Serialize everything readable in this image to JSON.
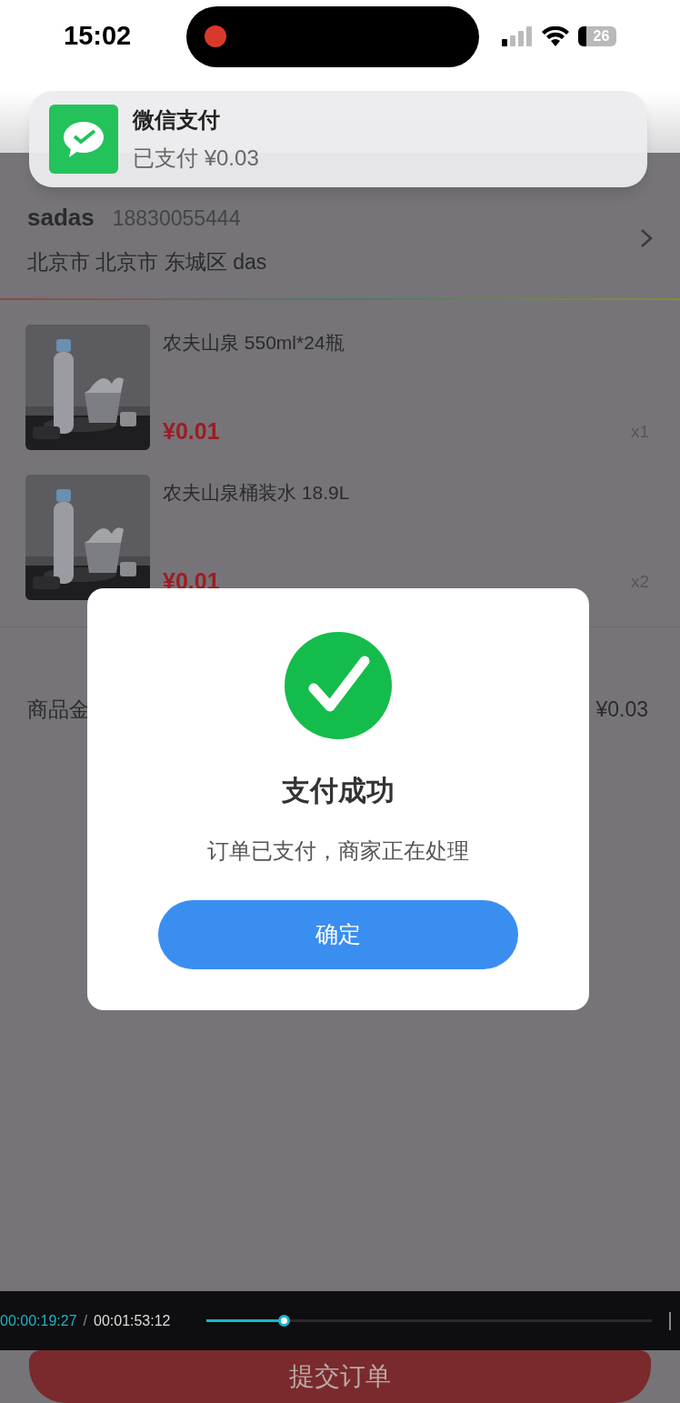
{
  "status_bar": {
    "time": "15:02",
    "battery": "26"
  },
  "notification": {
    "app": "微信支付",
    "message": "已支付 ¥0.03"
  },
  "address": {
    "name": "sadas",
    "phone": "18830055444",
    "detail": "北京市 北京市 东城区 das"
  },
  "items": [
    {
      "title": "农夫山泉 550ml*24瓶",
      "price": "¥0.01",
      "quantity": "x1"
    },
    {
      "title": "农夫山泉桶装水 18.9L",
      "price": "¥0.01",
      "quantity": "x2"
    }
  ],
  "subtotal": {
    "label": "商品金",
    "value": "¥0.03"
  },
  "submit_button": "提交订单",
  "dialog": {
    "title": "支付成功",
    "message": "订单已支付，商家正在处理",
    "button": "确定"
  },
  "player": {
    "current_time": "00:00:19:27",
    "separator": "/",
    "duration": "00:01:53:12",
    "level": 0.175
  }
}
